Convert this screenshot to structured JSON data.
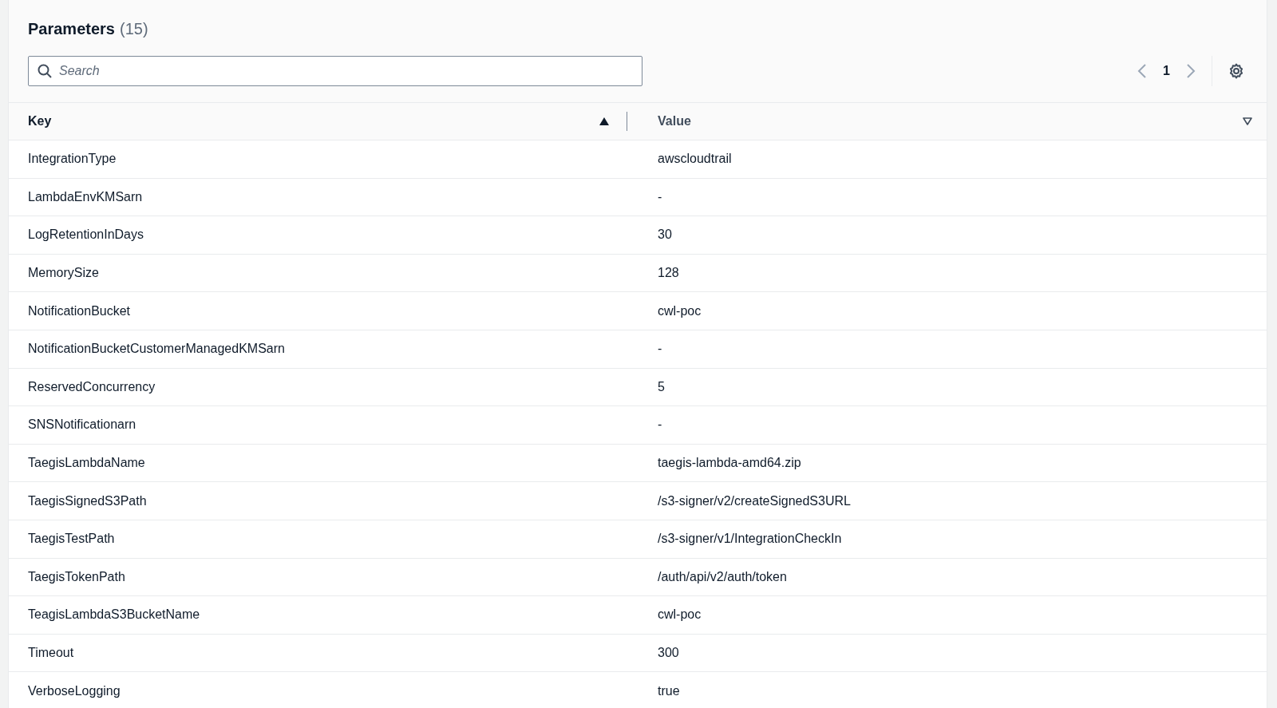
{
  "panel": {
    "title": "Parameters",
    "count": "(15)"
  },
  "search": {
    "placeholder": "Search"
  },
  "pagination": {
    "page": "1",
    "prev_disabled": true,
    "next_disabled": true
  },
  "table": {
    "columns": [
      {
        "label": "Key",
        "sorted": true
      },
      {
        "label": "Value",
        "sorted": false
      }
    ],
    "rows": [
      {
        "key": "IntegrationType",
        "value": "awscloudtrail"
      },
      {
        "key": "LambdaEnvKMSarn",
        "value": "-"
      },
      {
        "key": "LogRetentionInDays",
        "value": "30"
      },
      {
        "key": "MemorySize",
        "value": "128"
      },
      {
        "key": "NotificationBucket",
        "value": "cwl-poc"
      },
      {
        "key": "NotificationBucketCustomerManagedKMSarn",
        "value": "-"
      },
      {
        "key": "ReservedConcurrency",
        "value": "5"
      },
      {
        "key": "SNSNotificationarn",
        "value": "-"
      },
      {
        "key": "TaegisLambdaName",
        "value": "taegis-lambda-amd64.zip"
      },
      {
        "key": "TaegisSignedS3Path",
        "value": "/s3-signer/v2/createSignedS3URL"
      },
      {
        "key": "TaegisTestPath",
        "value": "/s3-signer/v1/IntegrationCheckIn"
      },
      {
        "key": "TaegisTokenPath",
        "value": "/auth/api/v2/auth/token"
      },
      {
        "key": "TeagisLambdaS3BucketName",
        "value": "cwl-poc"
      },
      {
        "key": "Timeout",
        "value": "300"
      },
      {
        "key": "VerboseLogging",
        "value": "true"
      }
    ]
  }
}
